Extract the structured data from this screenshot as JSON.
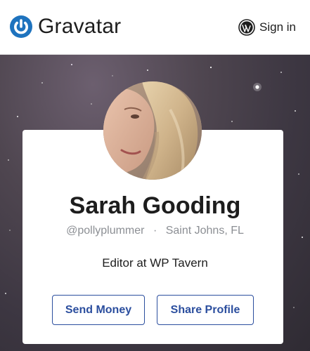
{
  "header": {
    "logo_text": "Gravatar",
    "signin_label": "Sign in"
  },
  "profile": {
    "name": "Sarah Gooding",
    "username": "@pollyplummer",
    "separator": "·",
    "location": "Saint Johns, FL",
    "bio": "Editor at WP Tavern"
  },
  "actions": {
    "send_money": "Send Money",
    "share_profile": "Share Profile"
  },
  "colors": {
    "brand_blue": "#1e73be",
    "button_blue": "#2b4e9e"
  },
  "icons": {
    "logo": "gravatar-power-icon",
    "signin": "wordpress-icon"
  }
}
